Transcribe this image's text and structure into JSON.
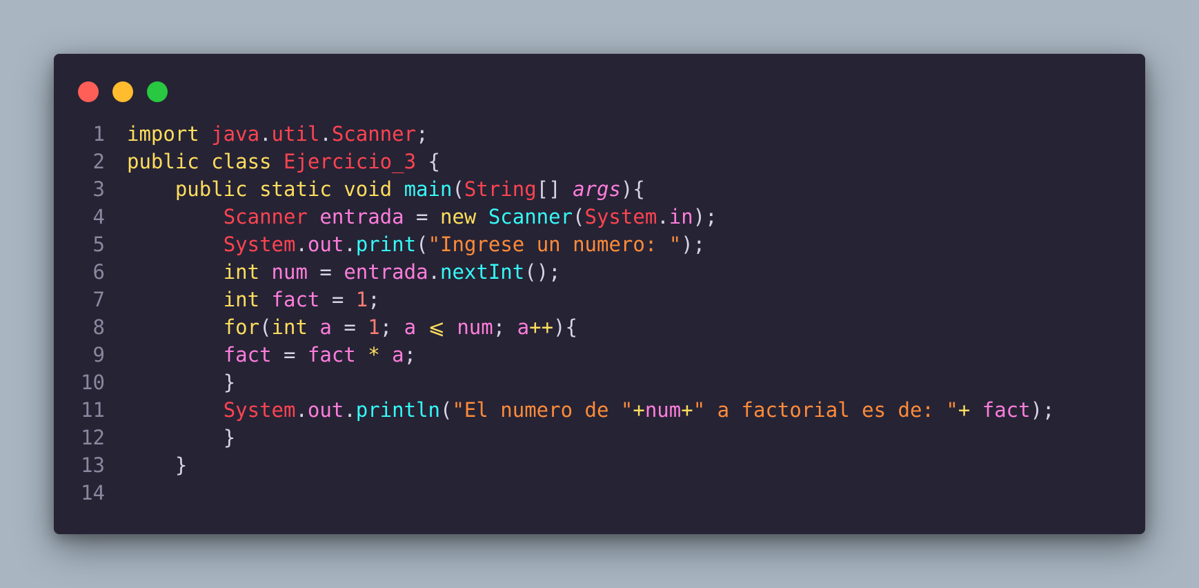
{
  "window": {
    "controls": {
      "close": "red-dot",
      "minimize": "yellow-dot",
      "maximize": "green-dot"
    }
  },
  "code": {
    "lines": [
      {
        "num": "1",
        "tokens": [
          {
            "t": "import ",
            "c": "kw"
          },
          {
            "t": "java",
            "c": "cls"
          },
          {
            "t": ".",
            "c": "pun"
          },
          {
            "t": "util",
            "c": "cls"
          },
          {
            "t": ".",
            "c": "pun"
          },
          {
            "t": "Scanner",
            "c": "cls"
          },
          {
            "t": ";",
            "c": "pun"
          }
        ]
      },
      {
        "num": "2",
        "tokens": [
          {
            "t": "public ",
            "c": "kw"
          },
          {
            "t": "class ",
            "c": "kw"
          },
          {
            "t": "Ejercicio_3",
            "c": "cls"
          },
          {
            "t": " {",
            "c": "pun"
          }
        ]
      },
      {
        "num": "3",
        "tokens": [
          {
            "t": "    ",
            "c": "pun"
          },
          {
            "t": "public ",
            "c": "kw"
          },
          {
            "t": "static ",
            "c": "kw"
          },
          {
            "t": "void ",
            "c": "kw"
          },
          {
            "t": "main",
            "c": "fn"
          },
          {
            "t": "(",
            "c": "pun"
          },
          {
            "t": "String",
            "c": "cls"
          },
          {
            "t": "[] ",
            "c": "pun"
          },
          {
            "t": "args",
            "c": "param"
          },
          {
            "t": "){",
            "c": "pun"
          }
        ]
      },
      {
        "num": "4",
        "tokens": [
          {
            "t": "        ",
            "c": "pun"
          },
          {
            "t": "Scanner ",
            "c": "cls"
          },
          {
            "t": "entrada",
            "c": "var"
          },
          {
            "t": " = ",
            "c": "pun"
          },
          {
            "t": "new ",
            "c": "kw"
          },
          {
            "t": "Scanner",
            "c": "fn"
          },
          {
            "t": "(",
            "c": "pun"
          },
          {
            "t": "System",
            "c": "cls"
          },
          {
            "t": ".",
            "c": "pun"
          },
          {
            "t": "in",
            "c": "var"
          },
          {
            "t": ");",
            "c": "pun"
          }
        ]
      },
      {
        "num": "5",
        "tokens": [
          {
            "t": "        ",
            "c": "pun"
          },
          {
            "t": "System",
            "c": "cls"
          },
          {
            "t": ".",
            "c": "pun"
          },
          {
            "t": "out",
            "c": "var"
          },
          {
            "t": ".",
            "c": "pun"
          },
          {
            "t": "print",
            "c": "fn"
          },
          {
            "t": "(",
            "c": "pun"
          },
          {
            "t": "\"Ingrese un numero: \"",
            "c": "str"
          },
          {
            "t": ");",
            "c": "pun"
          }
        ]
      },
      {
        "num": "6",
        "tokens": [
          {
            "t": "        ",
            "c": "pun"
          },
          {
            "t": "int ",
            "c": "kw"
          },
          {
            "t": "num",
            "c": "var"
          },
          {
            "t": " = ",
            "c": "pun"
          },
          {
            "t": "entrada",
            "c": "var"
          },
          {
            "t": ".",
            "c": "pun"
          },
          {
            "t": "nextInt",
            "c": "fn"
          },
          {
            "t": "();",
            "c": "pun"
          }
        ]
      },
      {
        "num": "7",
        "tokens": [
          {
            "t": "        ",
            "c": "pun"
          },
          {
            "t": "int ",
            "c": "kw"
          },
          {
            "t": "fact",
            "c": "var"
          },
          {
            "t": " = ",
            "c": "pun"
          },
          {
            "t": "1",
            "c": "num"
          },
          {
            "t": ";",
            "c": "pun"
          }
        ]
      },
      {
        "num": "8",
        "tokens": [
          {
            "t": "        ",
            "c": "pun"
          },
          {
            "t": "for",
            "c": "kw"
          },
          {
            "t": "(",
            "c": "pun"
          },
          {
            "t": "int ",
            "c": "kw"
          },
          {
            "t": "a",
            "c": "var"
          },
          {
            "t": " = ",
            "c": "pun"
          },
          {
            "t": "1",
            "c": "num"
          },
          {
            "t": "; ",
            "c": "pun"
          },
          {
            "t": "a",
            "c": "var"
          },
          {
            "t": " ⩽ ",
            "c": "op"
          },
          {
            "t": "num",
            "c": "var"
          },
          {
            "t": "; ",
            "c": "pun"
          },
          {
            "t": "a",
            "c": "var"
          },
          {
            "t": "++",
            "c": "op"
          },
          {
            "t": "){",
            "c": "pun"
          }
        ]
      },
      {
        "num": "9",
        "tokens": [
          {
            "t": "        ",
            "c": "pun"
          },
          {
            "t": "fact",
            "c": "var"
          },
          {
            "t": " = ",
            "c": "pun"
          },
          {
            "t": "fact",
            "c": "var"
          },
          {
            "t": " * ",
            "c": "op"
          },
          {
            "t": "a",
            "c": "var"
          },
          {
            "t": ";",
            "c": "pun"
          }
        ]
      },
      {
        "num": "10",
        "tokens": [
          {
            "t": "        ",
            "c": "pun"
          },
          {
            "t": "}",
            "c": "pun"
          }
        ]
      },
      {
        "num": "11",
        "tokens": [
          {
            "t": "        ",
            "c": "pun"
          },
          {
            "t": "System",
            "c": "cls"
          },
          {
            "t": ".",
            "c": "pun"
          },
          {
            "t": "out",
            "c": "var"
          },
          {
            "t": ".",
            "c": "pun"
          },
          {
            "t": "println",
            "c": "fn"
          },
          {
            "t": "(",
            "c": "pun"
          },
          {
            "t": "\"El numero de \"",
            "c": "str"
          },
          {
            "t": "+",
            "c": "op"
          },
          {
            "t": "num",
            "c": "var"
          },
          {
            "t": "+",
            "c": "op"
          },
          {
            "t": "\" a factorial es de: \"",
            "c": "str"
          },
          {
            "t": "+ ",
            "c": "op"
          },
          {
            "t": "fact",
            "c": "var"
          },
          {
            "t": ");",
            "c": "pun"
          }
        ]
      },
      {
        "num": "12",
        "tokens": [
          {
            "t": "        ",
            "c": "pun"
          },
          {
            "t": "}",
            "c": "pun"
          }
        ]
      },
      {
        "num": "13",
        "tokens": [
          {
            "t": "    ",
            "c": "pun"
          },
          {
            "t": "}",
            "c": "pun"
          }
        ]
      },
      {
        "num": "14",
        "tokens": []
      }
    ]
  },
  "theme": {
    "background": "#a9b6c2",
    "editor": "#262335",
    "keyword": "#fede5d",
    "class": "#fe4450",
    "function": "#36f9f6",
    "variable": "#ff7edb",
    "string": "#ff8b39",
    "number": "#f97e72",
    "line_number": "#8b879e"
  }
}
